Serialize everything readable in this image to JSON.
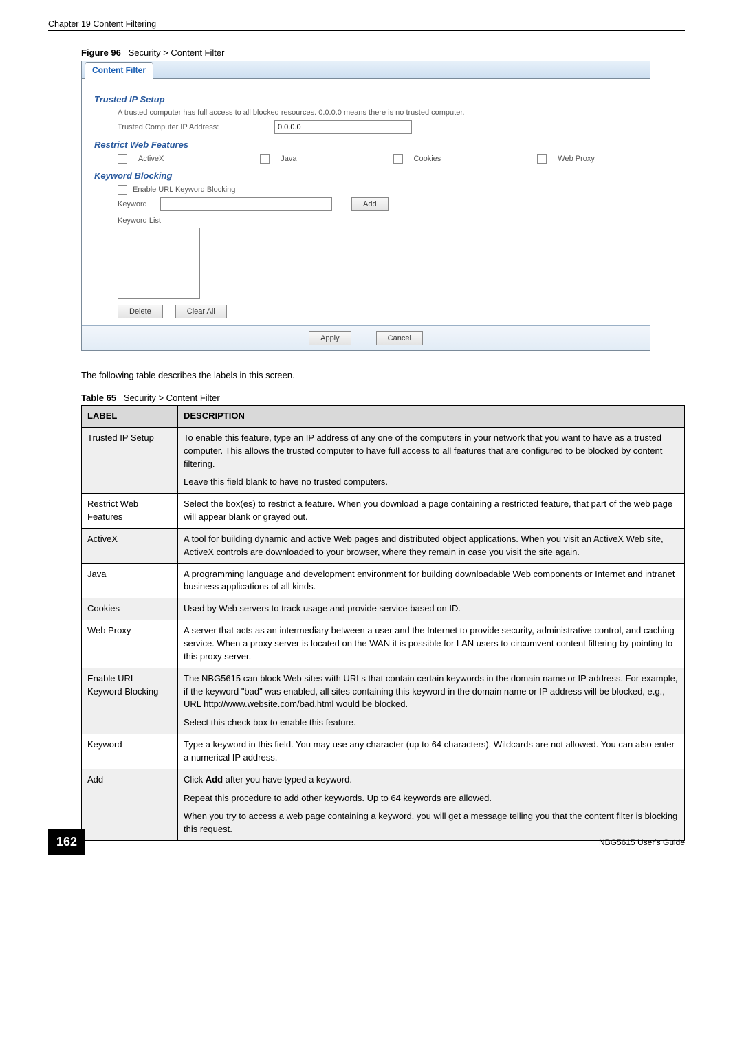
{
  "header": {
    "chapter": "Chapter 19 Content Filtering"
  },
  "figure": {
    "label": "Figure 96",
    "caption": "Security > Content Filter",
    "tab_label": "Content Filter",
    "sections": {
      "trusted": {
        "title": "Trusted IP Setup",
        "help": "A trusted computer has full access to all blocked resources. 0.0.0.0 means there is no trusted computer.",
        "ip_label": "Trusted Computer IP Address:",
        "ip_value": "0.0.0.0"
      },
      "restrict": {
        "title": "Restrict Web Features",
        "features": [
          "ActiveX",
          "Java",
          "Cookies",
          "Web Proxy"
        ]
      },
      "keyword": {
        "title": "Keyword Blocking",
        "enable_label": "Enable URL Keyword Blocking",
        "kw_label": "Keyword",
        "add_btn": "Add",
        "list_label": "Keyword List",
        "delete_btn": "Delete",
        "clear_btn": "Clear All"
      }
    },
    "apply_btn": "Apply",
    "cancel_btn": "Cancel"
  },
  "intro_para": "The following table describes the labels in this screen.",
  "table": {
    "label": "Table 65",
    "caption": "Security > Content Filter",
    "head": {
      "c1": "LABEL",
      "c2": "DESCRIPTION"
    },
    "rows": [
      {
        "label": "Trusted IP Setup",
        "desc": [
          "To enable this feature, type an IP address of any one of the computers in your network that you want to have as a trusted computer. This allows the trusted computer to have full access to all features that are configured to be blocked by content filtering.",
          "Leave this field blank to have no trusted computers."
        ]
      },
      {
        "label": "Restrict Web Features",
        "desc": [
          "Select the box(es) to restrict a feature. When you download a page containing a restricted feature, that part of the web page will appear blank or grayed out."
        ]
      },
      {
        "label": "ActiveX",
        "desc": [
          "A tool for building dynamic and active Web pages and distributed object applications. When you visit an ActiveX Web site, ActiveX controls are downloaded to your browser, where they remain in case you visit the site again."
        ]
      },
      {
        "label": "Java",
        "desc": [
          "A programming language and development environment for building downloadable Web components or Internet and intranet business applications of all kinds."
        ]
      },
      {
        "label": "Cookies",
        "desc": [
          "Used by Web servers to track usage and provide service based on ID."
        ]
      },
      {
        "label": "Web Proxy",
        "desc": [
          "A server that acts as an intermediary between a user and the Internet to provide security, administrative control, and caching service. When a proxy server is located on the WAN it is possible for LAN users to circumvent content filtering by pointing to this proxy server."
        ]
      },
      {
        "label": "Enable URL Keyword Blocking",
        "desc": [
          "The NBG5615 can block Web sites with URLs that contain certain keywords in the domain name or IP address. For example, if the keyword \"bad\" was enabled, all sites containing this keyword in the domain name or IP address will be blocked, e.g., URL http://www.website.com/bad.html would be blocked.",
          "Select this check box to enable this feature."
        ]
      },
      {
        "label": "Keyword",
        "desc": [
          "Type a keyword in this field. You may use any character (up to 64 characters). Wildcards are not allowed. You can also enter a numerical IP address."
        ]
      },
      {
        "label": "Add",
        "desc": [
          "Click <b>Add</b> after you have typed a keyword.",
          "Repeat this procedure to add other keywords. Up to 64 keywords are allowed.",
          "When you try to access a web page containing a keyword, you will get a message telling you that the content filter is blocking this request."
        ]
      }
    ]
  },
  "footer": {
    "page": "162",
    "guide": "NBG5615 User's Guide"
  }
}
